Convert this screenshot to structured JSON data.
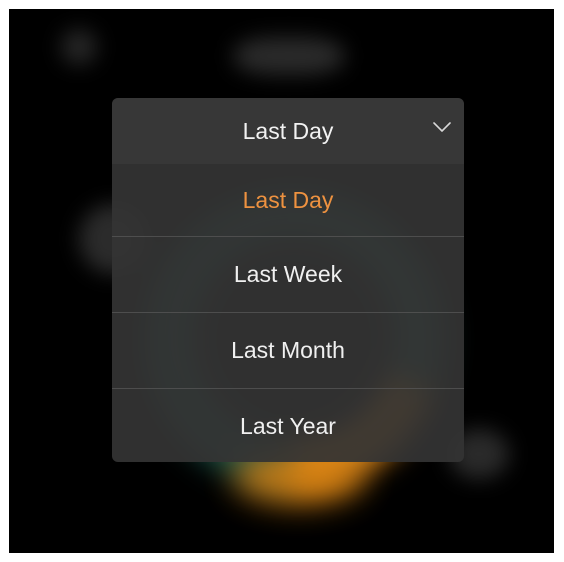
{
  "dropdown": {
    "selected_label": "Last Day",
    "options": [
      {
        "label": "Last Day",
        "selected": true
      },
      {
        "label": "Last Week",
        "selected": false
      },
      {
        "label": "Last Month",
        "selected": false
      },
      {
        "label": "Last Year",
        "selected": false
      }
    ],
    "icon": "chevron-down-icon"
  },
  "colors": {
    "selected_option": "#ee9240",
    "option_text": "#f0f0f0",
    "panel_background": "#343434",
    "screen_background": "#000000",
    "ring_orange": "#e08a1c",
    "ring_teal": "#21584c"
  }
}
